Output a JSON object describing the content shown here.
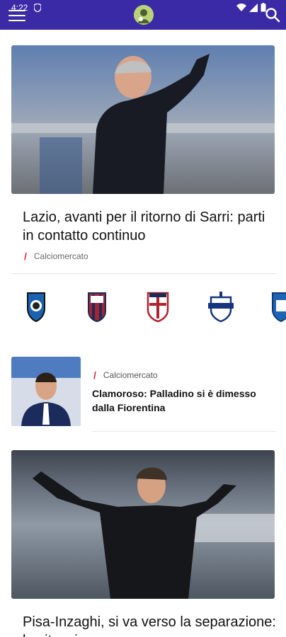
{
  "status_bar": {
    "time": "4:22"
  },
  "header": {
    "menu_icon": "hamburger-icon",
    "logo_icon": "site-logo",
    "search_icon": "search-icon",
    "bar_color": "#3b2aa6"
  },
  "articles": [
    {
      "title": "Lazio, avanti per il ritorno di Sarri: parti in contatto continuo",
      "category": "Calciomercato"
    },
    {
      "title": "Clamoroso: Palladino si è dimesso dalla Fiorentina",
      "category": "Calciomercato"
    },
    {
      "title": "Pisa-Inzaghi, si va verso la separazione: la situazione"
    }
  ],
  "teams": [
    "Atalanta",
    "Bologna",
    "Cagliari",
    "Como",
    "Empoli"
  ],
  "colors": {
    "accent": "#e2253b",
    "brand": "#3b2aa6"
  }
}
